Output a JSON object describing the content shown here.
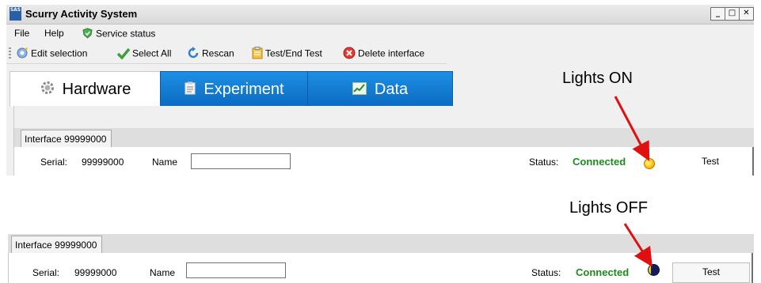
{
  "window": {
    "app_logo_text": "SAS",
    "title": "Scurry Activity System",
    "controls": {
      "minimize": "_",
      "maximize": "□",
      "close": "✕"
    }
  },
  "menu": {
    "file": "File",
    "help": "Help",
    "service_status": "Service status"
  },
  "toolbar": {
    "edit_selection": "Edit selection",
    "select_all": "Select All",
    "rescan": "Rescan",
    "test_end_test": "Test/End Test",
    "delete_interface": "Delete interface"
  },
  "tabs": [
    {
      "label": "Hardware",
      "icon": "gear-icon",
      "selected": true
    },
    {
      "label": "Experiment",
      "icon": "clipboard-icon",
      "selected": false
    },
    {
      "label": "Data",
      "icon": "chart-icon",
      "selected": false
    }
  ],
  "panel_on": {
    "group_label": "Interface 99999000",
    "serial_label": "Serial:",
    "serial_value": "99999000",
    "name_label": "Name",
    "name_value": "",
    "status_label": "Status:",
    "status_value": "Connected",
    "test_label": "Test"
  },
  "panel_off": {
    "group_label": "Interface 99999000",
    "serial_label": "Serial:",
    "serial_value": "99999000",
    "name_label": "Name",
    "name_value": "",
    "status_label": "Status:",
    "status_value": "Connected",
    "test_label": "Test"
  },
  "annotations": {
    "lights_on": "Lights ON",
    "lights_off": "Lights OFF"
  },
  "colors": {
    "connected": "#1c8c1c",
    "tab_blue": "#0b6ac2",
    "arrow_red": "#e01010",
    "light_on": "#ffd11a",
    "light_off": "#131d5e"
  }
}
